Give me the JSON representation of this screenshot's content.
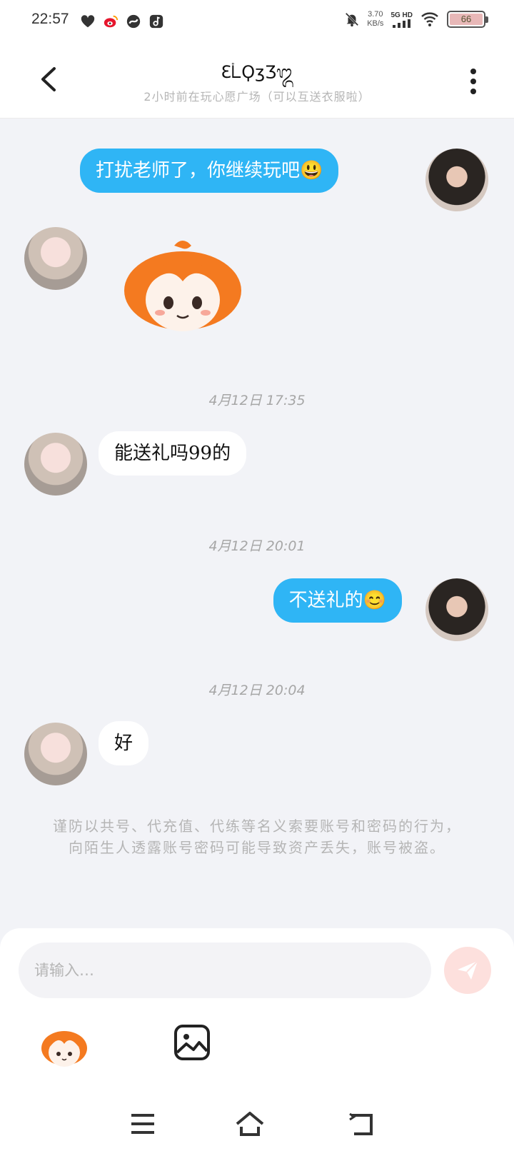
{
  "status_bar": {
    "time": "22:57",
    "net_speed_value": "3.70",
    "net_speed_unit": "KB/s",
    "network": "5G HD",
    "battery": "66",
    "icons": [
      "heart-icon",
      "weibo-icon",
      "loop-app-icon",
      "music-app-icon",
      "mute-bell-icon",
      "signal-icon",
      "wifi-icon",
      "battery-icon"
    ]
  },
  "header": {
    "title": "ƐᢺϘʒƷ᭓",
    "subtitle": "2小时前在玩心愿广场（可以互送衣服啦）"
  },
  "messages": [
    {
      "side": "self",
      "text": "打扰老师了，你继续玩吧😃"
    },
    {
      "side": "other",
      "type": "sticker",
      "sticker": "orange-hair-chibi-sticker"
    },
    {
      "type": "time",
      "text": "4月12日 17:35"
    },
    {
      "side": "other",
      "text": "能送礼吗99的"
    },
    {
      "type": "time",
      "text": "4月12日 20:01"
    },
    {
      "side": "self",
      "text": "不送礼的😊"
    },
    {
      "type": "time",
      "text": "4月12日 20:04"
    },
    {
      "side": "other",
      "text": "好"
    }
  ],
  "notice": "谨防以共号、代充值、代练等名义索要账号和密码的行为，向陌生人透露账号密码可能导致资产丢失，账号被盗。",
  "input": {
    "placeholder": "请输入…"
  },
  "colors": {
    "self_bubble": "#2fb5f5",
    "other_bubble": "#ffffff",
    "send_button": "#fde0dd",
    "background": "#f2f3f7"
  }
}
